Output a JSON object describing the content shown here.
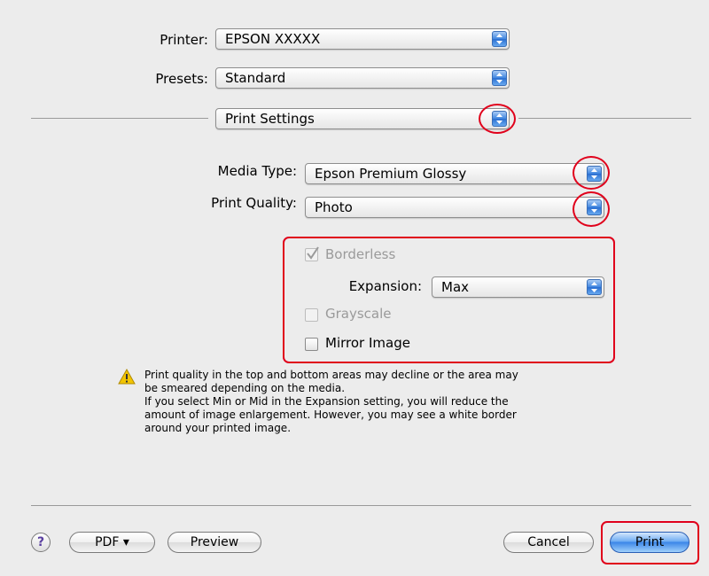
{
  "printer": {
    "label": "Printer:",
    "value": "EPSON XXXXX"
  },
  "presets": {
    "label": "Presets:",
    "value": "Standard"
  },
  "panel": {
    "value": "Print Settings"
  },
  "media_type": {
    "label": "Media Type:",
    "value": "Epson Premium Glossy"
  },
  "print_quality": {
    "label": "Print Quality:",
    "value": "Photo"
  },
  "borderless": {
    "label": "Borderless",
    "checked": true,
    "enabled": false
  },
  "expansion": {
    "label": "Expansion:",
    "value": "Max"
  },
  "grayscale": {
    "label": "Grayscale",
    "checked": false,
    "enabled": false
  },
  "mirror_image": {
    "label": "Mirror Image",
    "checked": false,
    "enabled": true
  },
  "warning": {
    "lines": [
      "Print quality in the top and bottom areas may decline or the area may",
      "be smeared depending on the media.",
      "If you select Min or Mid in the Expansion setting, you will reduce the",
      "amount of image enlargement. However, you may see a white border",
      "around your printed image."
    ]
  },
  "buttons": {
    "help": "?",
    "pdf": "PDF ▾",
    "preview": "Preview",
    "cancel": "Cancel",
    "print": "Print"
  },
  "colors": {
    "highlight": "#e0001b",
    "accent": "#3b86e8"
  }
}
